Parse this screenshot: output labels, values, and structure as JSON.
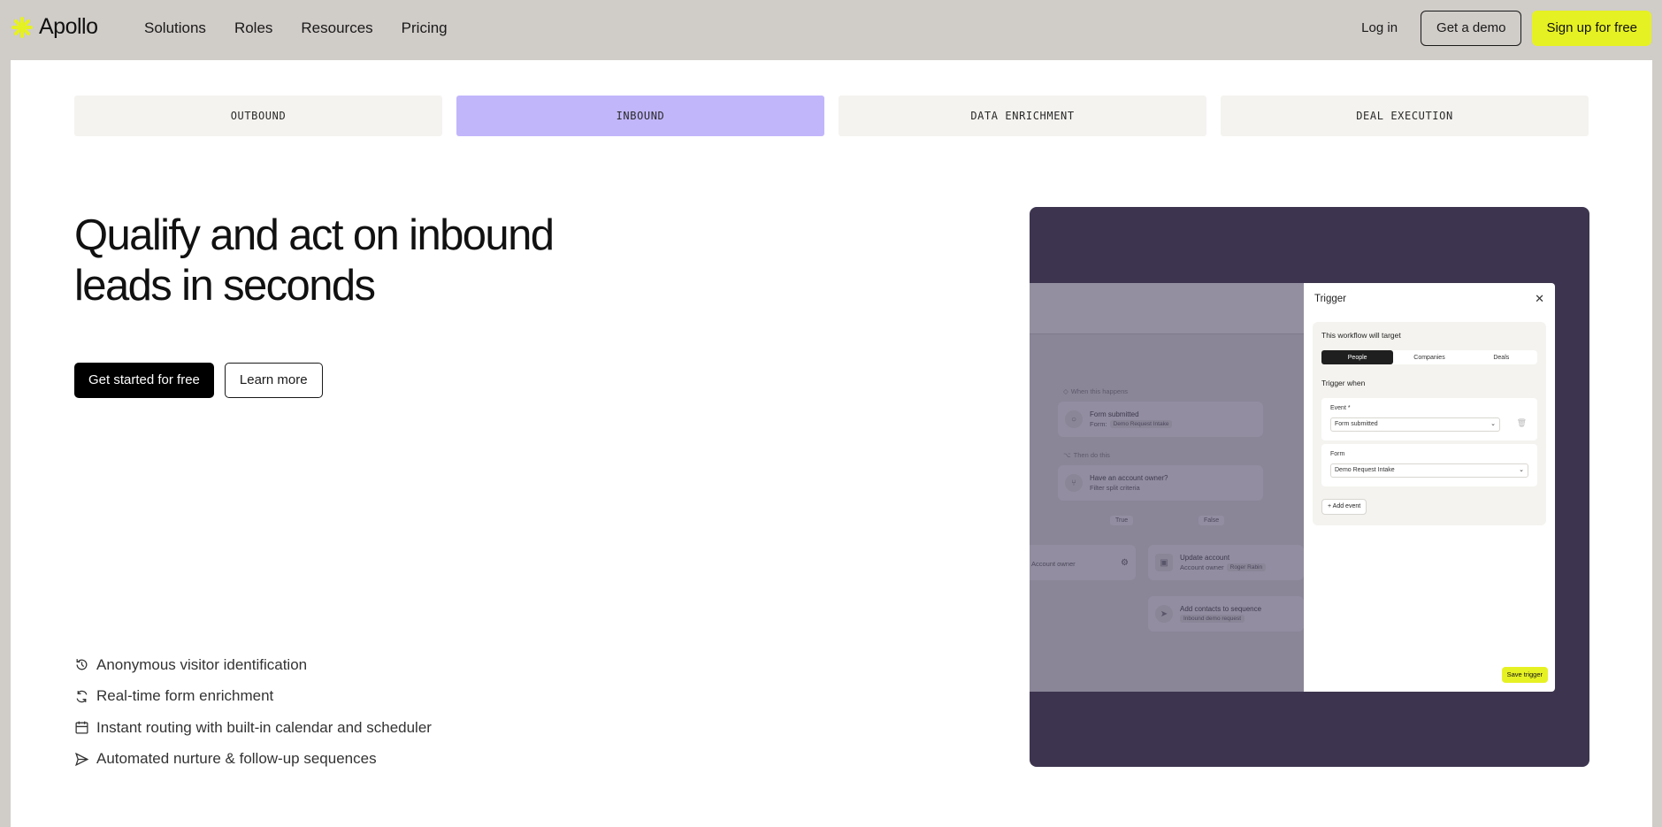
{
  "nav": {
    "brand": "Apollo",
    "links": [
      "Solutions",
      "Roles",
      "Resources",
      "Pricing"
    ],
    "login": "Log in",
    "demo": "Get a demo",
    "signup": "Sign up for free"
  },
  "tabs": [
    {
      "label": "OUTBOUND",
      "active": false
    },
    {
      "label": "INBOUND",
      "active": true
    },
    {
      "label": "DATA ENRICHMENT",
      "active": false
    },
    {
      "label": "DEAL EXECUTION",
      "active": false
    }
  ],
  "hero": {
    "headline_line1": "Qualify and act on inbound",
    "headline_line2": "leads in seconds",
    "primary_cta": "Get started for free",
    "secondary_cta": "Learn more"
  },
  "features": [
    {
      "icon": "history-icon",
      "text": "Anonymous visitor identification"
    },
    {
      "icon": "refresh-icon",
      "text": "Real-time form enrichment"
    },
    {
      "icon": "calendar-icon",
      "text": "Instant routing with built-in calendar and scheduler"
    },
    {
      "icon": "send-icon",
      "text": "Automated nurture & follow-up sequences"
    }
  ],
  "workflow": {
    "when_label": "When this happens",
    "node1_title": "Form submitted",
    "node1_sub_label": "Form:",
    "node1_pill": "Demo Request Intake",
    "then_label": "Then do this",
    "node2_title": "Have an account owner?",
    "node2_sub": "Filter split criteria",
    "true_chip": "True",
    "false_chip": "False",
    "left_node_sub": "Account owner",
    "node3_title": "Update account",
    "node3_sub_label": "Account owner",
    "node3_pill": "Roger Rabin",
    "node4_title": "Add contacts to sequence",
    "node4_pill": "Inbound demo request"
  },
  "trigger_panel": {
    "title": "Trigger",
    "target_label": "This workflow will target",
    "segments": [
      "People",
      "Companies",
      "Deals"
    ],
    "trigger_when": "Trigger when",
    "event_label": "Event *",
    "event_value": "Form submitted",
    "form_label": "Form",
    "form_value": "Demo Request Intake",
    "add_event": "+ Add event",
    "save": "Save trigger"
  },
  "colors": {
    "brand_yellow": "#e6f123",
    "active_tab": "#c2b6fb",
    "illustration_bg": "#3d354f"
  }
}
